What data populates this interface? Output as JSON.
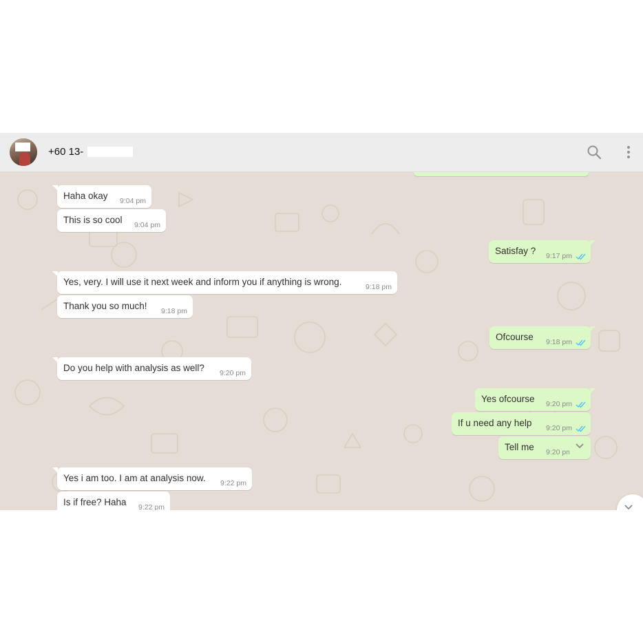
{
  "header": {
    "contact_name": "+60 13-",
    "icons": [
      "search-icon",
      "menu-icon"
    ]
  },
  "colors": {
    "header_bg": "#ededed",
    "chat_bg": "#e5ddd5",
    "incoming_bg": "#ffffff",
    "outgoing_bg": "#dcf8c6",
    "read_tick": "#4fc3f7"
  },
  "messages": [
    {
      "dir": "in",
      "text": "Haha okay",
      "time": "9:04 pm"
    },
    {
      "dir": "in",
      "text": "This is so cool",
      "time": "9:04 pm"
    },
    {
      "dir": "out",
      "text": "Satisfay ?",
      "time": "9:17 pm",
      "status": "read"
    },
    {
      "dir": "in",
      "text": "Yes, very. I will use it next week and inform you if anything is wrong.",
      "time": "9:18 pm"
    },
    {
      "dir": "in",
      "text": "Thank you so much!",
      "time": "9:18 pm"
    },
    {
      "dir": "out",
      "text": "Ofcourse",
      "time": "9:18 pm",
      "status": "read"
    },
    {
      "dir": "in",
      "text": "Do you help with analysis as well?",
      "time": "9:20 pm"
    },
    {
      "dir": "out",
      "text": "Yes ofcourse",
      "time": "9:20 pm",
      "status": "read"
    },
    {
      "dir": "out",
      "text": "If u need any help",
      "time": "9:20 pm",
      "status": "read"
    },
    {
      "dir": "out",
      "text": "Tell me",
      "time": "9:20 pm",
      "status": "hover-menu"
    },
    {
      "dir": "in",
      "text": "Yes i am too. I am at analysis now.",
      "time": "9:22 pm"
    },
    {
      "dir": "in",
      "text": "Is if free? Haha",
      "time": "9:22 pm"
    }
  ]
}
